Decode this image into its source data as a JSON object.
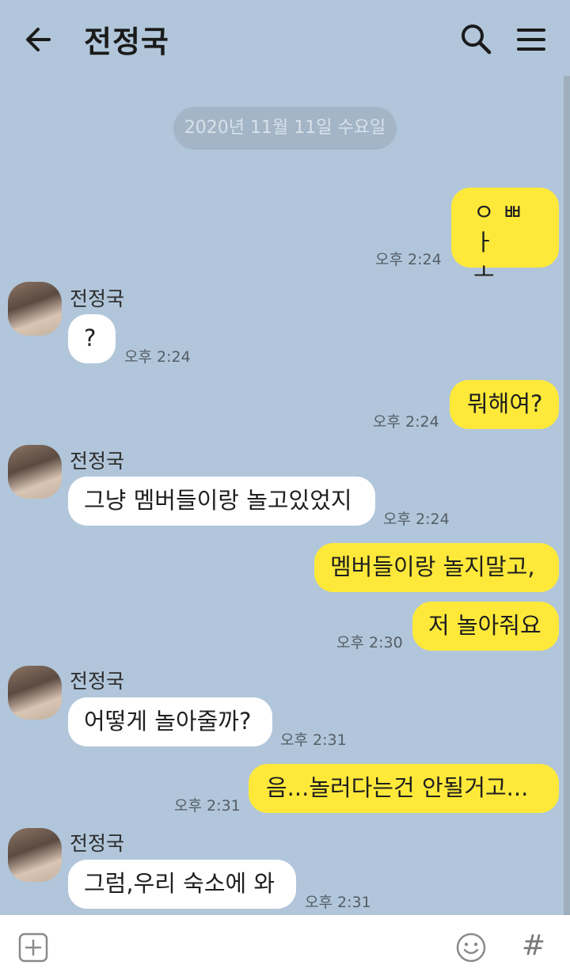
{
  "header": {
    "title": "전정국",
    "back_icon": "arrow-left-icon",
    "search_icon": "search-icon",
    "menu_icon": "hamburger-menu-icon"
  },
  "date_divider": "2020년 11월 11일 수요일",
  "messages": [
    {
      "from": "me",
      "text_line1": "ㅇ ㅃ ㅏ",
      "text_line2": "ㅗ",
      "time": "오후 2:24"
    },
    {
      "from": "other",
      "sender": "전정국",
      "text": "?",
      "time": "오후 2:24"
    },
    {
      "from": "me",
      "text": "뭐해여?",
      "time": "오후 2:24"
    },
    {
      "from": "other",
      "sender": "전정국",
      "text": "그냥 멤버들이랑 놀고있었지",
      "time": "오후 2:24"
    },
    {
      "from": "me",
      "text": "멤버들이랑 놀지말고,"
    },
    {
      "from": "me",
      "text": "저 놀아줘요",
      "time": "오후 2:30"
    },
    {
      "from": "other",
      "sender": "전정국",
      "text": "어떻게 놀아줄까?",
      "time": "오후 2:31"
    },
    {
      "from": "me",
      "text": "음...놀러다는건 안될거고...",
      "time": "오후 2:31"
    },
    {
      "from": "other",
      "sender": "전정국",
      "text": "그럼,우리 숙소에 와",
      "time": "오후 2:31"
    }
  ],
  "footer": {
    "plus_icon": "plus-square-icon",
    "emoji_icon": "smiley-icon",
    "hash_label": "#"
  },
  "colors": {
    "background": "#b1c6da",
    "my_bubble": "#fee93a",
    "other_bubble": "#ffffff"
  }
}
